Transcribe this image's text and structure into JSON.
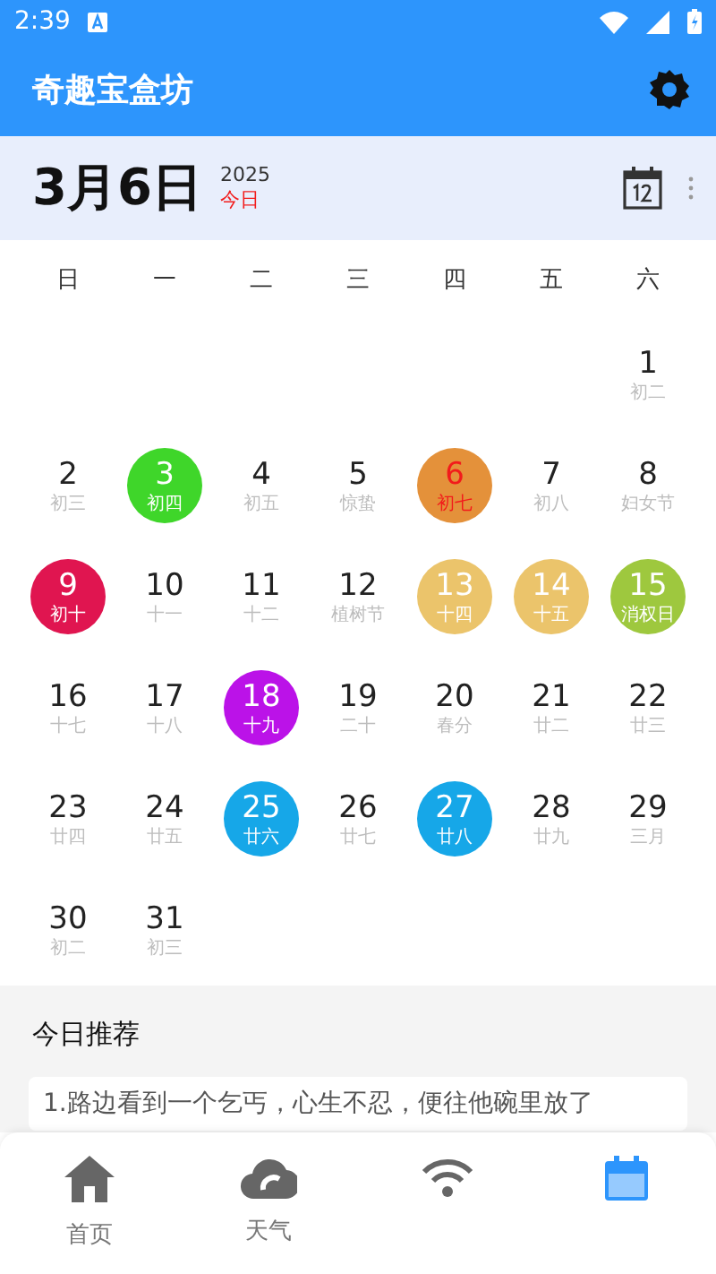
{
  "status_bar": {
    "time": "2:39"
  },
  "app_bar": {
    "title": "奇趣宝盒坊"
  },
  "date_header": {
    "date": "3月6日",
    "year": "2025",
    "today_label": "今日"
  },
  "weekdays": [
    "日",
    "一",
    "二",
    "三",
    "四",
    "五",
    "六"
  ],
  "weeks": [
    [
      {
        "kind": "blank"
      },
      {
        "kind": "blank"
      },
      {
        "kind": "blank"
      },
      {
        "kind": "blank"
      },
      {
        "kind": "blank"
      },
      {
        "kind": "blank"
      },
      {
        "kind": "day",
        "day": "1",
        "lunar": "初二",
        "today": false
      }
    ],
    [
      {
        "kind": "day",
        "day": "2",
        "lunar": "初三",
        "today": false
      },
      {
        "kind": "day",
        "day": "3",
        "lunar": "初四",
        "today": false,
        "color": "#3fd62a"
      },
      {
        "kind": "day",
        "day": "4",
        "lunar": "初五",
        "today": false
      },
      {
        "kind": "day",
        "day": "5",
        "lunar": "惊蛰",
        "today": false
      },
      {
        "kind": "day",
        "day": "6",
        "lunar": "初七",
        "today": true,
        "color": "#e4913a"
      },
      {
        "kind": "day",
        "day": "7",
        "lunar": "初八",
        "today": false
      },
      {
        "kind": "day",
        "day": "8",
        "lunar": "妇女节",
        "today": false
      }
    ],
    [
      {
        "kind": "day",
        "day": "9",
        "lunar": "初十",
        "today": false,
        "color": "#e01550"
      },
      {
        "kind": "day",
        "day": "10",
        "lunar": "十一",
        "today": false
      },
      {
        "kind": "day",
        "day": "11",
        "lunar": "十二",
        "today": false
      },
      {
        "kind": "day",
        "day": "12",
        "lunar": "植树节",
        "today": false
      },
      {
        "kind": "day",
        "day": "13",
        "lunar": "十四",
        "today": false,
        "color": "#ebc46b"
      },
      {
        "kind": "day",
        "day": "14",
        "lunar": "十五",
        "today": false,
        "color": "#ebc46b"
      },
      {
        "kind": "day",
        "day": "15",
        "lunar": "消权日",
        "today": false,
        "color": "#9ec83e"
      }
    ],
    [
      {
        "kind": "day",
        "day": "16",
        "lunar": "十七",
        "today": false
      },
      {
        "kind": "day",
        "day": "17",
        "lunar": "十八",
        "today": false
      },
      {
        "kind": "day",
        "day": "18",
        "lunar": "十九",
        "today": false,
        "color": "#bb12e8"
      },
      {
        "kind": "day",
        "day": "19",
        "lunar": "二十",
        "today": false
      },
      {
        "kind": "day",
        "day": "20",
        "lunar": "春分",
        "today": false
      },
      {
        "kind": "day",
        "day": "21",
        "lunar": "廿二",
        "today": false
      },
      {
        "kind": "day",
        "day": "22",
        "lunar": "廿三",
        "today": false
      }
    ],
    [
      {
        "kind": "day",
        "day": "23",
        "lunar": "廿四",
        "today": false
      },
      {
        "kind": "day",
        "day": "24",
        "lunar": "廿五",
        "today": false
      },
      {
        "kind": "day",
        "day": "25",
        "lunar": "廿六",
        "today": false,
        "color": "#16a7e8"
      },
      {
        "kind": "day",
        "day": "26",
        "lunar": "廿七",
        "today": false
      },
      {
        "kind": "day",
        "day": "27",
        "lunar": "廿八",
        "today": false,
        "color": "#16a7e8"
      },
      {
        "kind": "day",
        "day": "28",
        "lunar": "廿九",
        "today": false
      },
      {
        "kind": "day",
        "day": "29",
        "lunar": "三月",
        "today": false
      }
    ],
    [
      {
        "kind": "day",
        "day": "30",
        "lunar": "初二",
        "today": false
      },
      {
        "kind": "day",
        "day": "31",
        "lunar": "初三",
        "today": false
      }
    ]
  ],
  "recommend": {
    "title": "今日推荐",
    "items": [
      "1.路边看到一个乞丐，心生不忍，便往他碗里放了"
    ]
  },
  "bottom_nav": [
    {
      "kind": "home",
      "label": "首页",
      "selected": false
    },
    {
      "kind": "cloud",
      "label": "天气",
      "selected": false
    },
    {
      "kind": "signal",
      "selected": false
    },
    {
      "kind": "calendar",
      "selected": true
    }
  ]
}
